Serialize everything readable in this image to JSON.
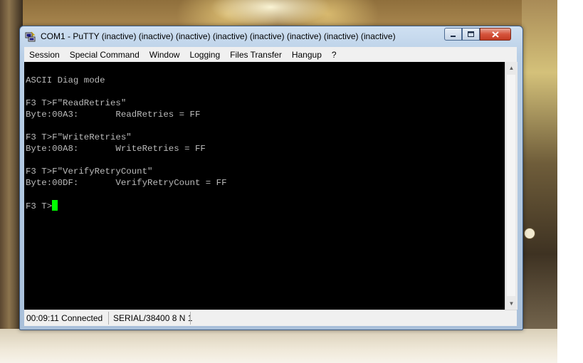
{
  "window": {
    "title": "COM1 - PuTTY (inactive) (inactive) (inactive) (inactive) (inactive) (inactive) (inactive) (inactive)",
    "app_icon": "putty-computer-icon",
    "buttons": {
      "minimize": "minimize-icon",
      "maximize": "maximize-icon",
      "close": "close-icon"
    }
  },
  "menu": [
    {
      "label": "Session"
    },
    {
      "label": "Special Command"
    },
    {
      "label": "Window"
    },
    {
      "label": "Logging"
    },
    {
      "label": "Files Transfer"
    },
    {
      "label": "Hangup"
    },
    {
      "label": "?"
    }
  ],
  "terminal": {
    "lines": [
      "ASCII Diag mode",
      "F3 T>F\"ReadRetries\"",
      "Byte:00A3:       ReadRetries = FF",
      "F3 T>F\"WriteRetries\"",
      "Byte:00A8:       WriteRetries = FF",
      "F3 T>F\"VerifyRetryCount\"",
      "Byte:00DF:       VerifyRetryCount = FF",
      "F3 T>"
    ],
    "cursor_color": "#00ff00",
    "background": "#000000",
    "foreground": "#bbbbbb"
  },
  "status": {
    "time_connection": "00:09:11 Connected",
    "serial": "SERIAL/38400 8 N 1"
  }
}
